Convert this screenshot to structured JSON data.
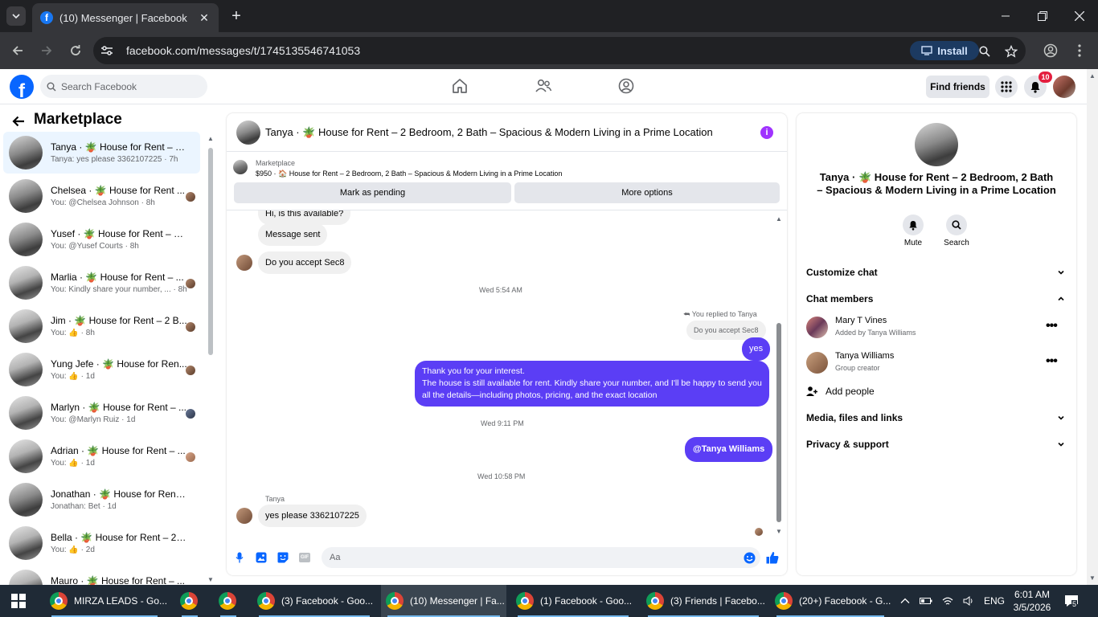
{
  "browser": {
    "tab_title": "(10) Messenger | Facebook",
    "url": "facebook.com/messages/t/1745135546741053",
    "install_label": "Install"
  },
  "fb": {
    "search_placeholder": "Search Facebook",
    "find_friends": "Find friends",
    "notifications_count": "10"
  },
  "sidebar": {
    "title": "Marketplace",
    "conversations": [
      {
        "name": "Tanya · 🪴 House for Rent – 2 B...",
        "preview": "Tanya: yes please 3362107225 · 7h"
      },
      {
        "name": "Chelsea · 🪴 House for Rent ...",
        "preview": "You: @Chelsea Johnson · 8h"
      },
      {
        "name": "Yusef · 🪴 House for Rent – 2 B...",
        "preview": "You: @Yusef Courts · 8h"
      },
      {
        "name": "Marlia · 🪴 House for Rent – ...",
        "preview": "You: Kindly share your number, ... · 8h"
      },
      {
        "name": "Jim · 🪴 House for Rent – 2 B...",
        "preview": "You: 👍 · 8h"
      },
      {
        "name": "Yung Jefe · 🪴 House for Ren...",
        "preview": "You: 👍 · 1d"
      },
      {
        "name": "Marlyn · 🪴 House for Rent – ...",
        "preview": "You: @Marlyn Ruiz · 1d"
      },
      {
        "name": "Adrian · 🪴 House for Rent – ...",
        "preview": "You: 👍 · 1d"
      },
      {
        "name": "Jonathan · 🪴 House for Rent – ...",
        "preview": "Jonathan: Bet · 1d"
      },
      {
        "name": "Bella · 🪴 House for Rent – 2 Be...",
        "preview": "You: 👍 · 2d"
      },
      {
        "name": "Mauro · 🪴 House for Rent – ...",
        "preview": ""
      }
    ]
  },
  "chat": {
    "title": "Tanya · 🪴 House for Rent – 2 Bedroom, 2 Bath – Spacious & Modern Living in a Prime Location",
    "marketplace_label": "Marketplace",
    "listing_line": "$950 · 🏠 House for Rent – 2 Bedroom, 2 Bath – Spacious & Modern Living in a Prime Location",
    "mark_pending": "Mark as pending",
    "more_options": "More options",
    "msg_cut": "Hi, is this available?",
    "msg_sent": "Message sent",
    "msg_sec8": "Do you accept Sec8",
    "ts1": "Wed 5:54 AM",
    "replied_to": "You replied to Tanya",
    "quoted": "Do you accept Sec8",
    "msg_yes": "yes",
    "msg_long_1": "Thank you for your interest.",
    "msg_long_2": "The house is still available for rent. Kindly share your number, and I'll be happy to send you all the details—including photos, pricing, and the exact location",
    "ts2": "Wed 9:11 PM",
    "msg_mention": "@Tanya Williams",
    "ts3": "Wed 10:58 PM",
    "sender_name": "Tanya",
    "msg_last": "yes please 3362107225",
    "composer_placeholder": "Aa"
  },
  "info": {
    "title": "Tanya · 🪴 House for Rent – 2 Bedroom, 2 Bath – Spacious & Modern Living in a Prime Location",
    "mute": "Mute",
    "search": "Search",
    "customize": "Customize chat",
    "members_header": "Chat members",
    "member1_name": "Mary T Vines",
    "member1_sub": "Added by Tanya Williams",
    "member2_name": "Tanya Williams",
    "member2_sub": "Group creator",
    "add_people": "Add people",
    "media": "Media, files and links",
    "privacy": "Privacy & support"
  },
  "taskbar": {
    "items": [
      "MIRZA LEADS - Go...",
      "",
      "",
      "(3) Facebook - Goo...",
      "(10) Messenger | Fa...",
      "(1) Facebook - Goo...",
      "(3) Friends | Facebo...",
      "(20+) Facebook - G..."
    ],
    "lang": "ENG",
    "time": "6:01 AM",
    "date": "3/5/2026",
    "notif": "5"
  },
  "colors": {
    "brand": "#0866ff",
    "my_bubble": "#5b3ef5",
    "info_accent": "#a033ff"
  }
}
